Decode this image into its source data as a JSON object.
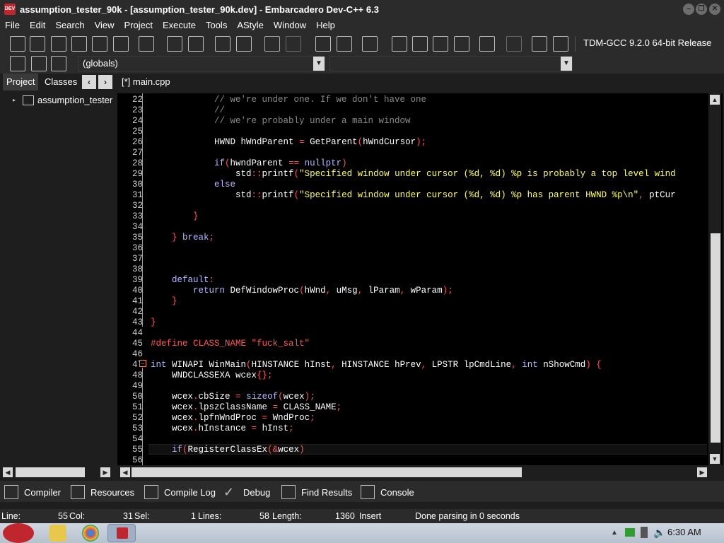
{
  "window": {
    "title": "assumption_tester_90k - [assumption_tester_90k.dev] - Embarcadero Dev-C++ 6.3",
    "logo_text": "DEV"
  },
  "menu": [
    "File",
    "Edit",
    "Search",
    "View",
    "Project",
    "Execute",
    "Tools",
    "AStyle",
    "Window",
    "Help"
  ],
  "toolbar": {
    "compiler": "TDM-GCC 9.2.0 64-bit Release",
    "scope": "(globals)"
  },
  "left_panel": {
    "tabs": [
      "Project",
      "Classes"
    ],
    "tree_item": "assumption_tester"
  },
  "editor": {
    "tab_label": "[*] main.cpp",
    "lines": [
      {
        "n": "22",
        "segs": [
          [
            "cm",
            "            // we're under one. If we don't have one"
          ]
        ]
      },
      {
        "n": "23",
        "segs": [
          [
            "cm",
            "            //"
          ]
        ]
      },
      {
        "n": "24",
        "segs": [
          [
            "cm",
            "            // we're probably under a main window"
          ]
        ]
      },
      {
        "n": "25",
        "segs": []
      },
      {
        "n": "26",
        "segs": [
          [
            "id",
            "            HWND hWndParent "
          ],
          [
            "sy",
            "="
          ],
          [
            "id",
            " GetParent"
          ],
          [
            "sy",
            "("
          ],
          [
            "id",
            "hWndCursor"
          ],
          [
            "sy",
            ");"
          ]
        ]
      },
      {
        "n": "27",
        "segs": []
      },
      {
        "n": "28",
        "segs": [
          [
            "kw",
            "            if"
          ],
          [
            "sy",
            "("
          ],
          [
            "id",
            "hwndParent "
          ],
          [
            "sy",
            "=="
          ],
          [
            "kw",
            " nullptr"
          ],
          [
            "sy",
            ")"
          ]
        ]
      },
      {
        "n": "29",
        "segs": [
          [
            "id",
            "                std"
          ],
          [
            "sy",
            "::"
          ],
          [
            "id",
            "printf"
          ],
          [
            "sy",
            "("
          ],
          [
            "st",
            "\"Specified window under cursor (%d, %d) %p is probably a top level wind"
          ]
        ]
      },
      {
        "n": "30",
        "segs": [
          [
            "kw",
            "            else"
          ]
        ]
      },
      {
        "n": "31",
        "segs": [
          [
            "id",
            "                std"
          ],
          [
            "sy",
            "::"
          ],
          [
            "id",
            "printf"
          ],
          [
            "sy",
            "("
          ],
          [
            "st",
            "\"Specified window under cursor (%d, %d) %p has parent HWND %p\\n\""
          ],
          [
            "sy",
            ","
          ],
          [
            "id",
            " ptCur"
          ]
        ]
      },
      {
        "n": "32",
        "segs": []
      },
      {
        "n": "33",
        "segs": [
          [
            "sy",
            "        }"
          ]
        ]
      },
      {
        "n": "34",
        "segs": []
      },
      {
        "n": "35",
        "segs": [
          [
            "sy",
            "    }"
          ],
          [
            "kw",
            " break"
          ],
          [
            "sy",
            ";"
          ]
        ]
      },
      {
        "n": "36",
        "segs": []
      },
      {
        "n": "37",
        "segs": []
      },
      {
        "n": "38",
        "segs": []
      },
      {
        "n": "39",
        "segs": [
          [
            "kw",
            "    default"
          ],
          [
            "sy",
            ":"
          ]
        ]
      },
      {
        "n": "40",
        "segs": [
          [
            "kw",
            "        return"
          ],
          [
            "id",
            " DefWindowProc"
          ],
          [
            "sy",
            "("
          ],
          [
            "id",
            "hWnd"
          ],
          [
            "sy",
            ","
          ],
          [
            "id",
            " uMsg"
          ],
          [
            "sy",
            ","
          ],
          [
            "id",
            " lParam"
          ],
          [
            "sy",
            ","
          ],
          [
            "id",
            " wParam"
          ],
          [
            "sy",
            ");"
          ]
        ]
      },
      {
        "n": "41",
        "segs": [
          [
            "sy",
            "    }"
          ]
        ]
      },
      {
        "n": "42",
        "segs": []
      },
      {
        "n": "43",
        "segs": [
          [
            "sy",
            "}"
          ]
        ]
      },
      {
        "n": "44",
        "segs": []
      },
      {
        "n": "45",
        "segs": [
          [
            "pp",
            "#define CLASS_NAME \"fuck_salt\""
          ]
        ]
      },
      {
        "n": "46",
        "segs": []
      },
      {
        "n": "47",
        "segs": [
          [
            "kw",
            "int"
          ],
          [
            "id",
            " WINAPI WinMain"
          ],
          [
            "sy",
            "("
          ],
          [
            "id",
            "HINSTANCE hInst"
          ],
          [
            "sy",
            ","
          ],
          [
            "id",
            " HINSTANCE hPrev"
          ],
          [
            "sy",
            ","
          ],
          [
            "id",
            " LPSTR lpCmdLine"
          ],
          [
            "sy",
            ","
          ],
          [
            "kw",
            " int"
          ],
          [
            "id",
            " nShowCmd"
          ],
          [
            "sy",
            ") {"
          ]
        ]
      },
      {
        "n": "48",
        "segs": [
          [
            "id",
            "    WNDCLASSEXA wcex"
          ],
          [
            "sy",
            "{};"
          ]
        ]
      },
      {
        "n": "49",
        "segs": []
      },
      {
        "n": "50",
        "segs": [
          [
            "id",
            "    wcex"
          ],
          [
            "sy",
            "."
          ],
          [
            "id",
            "cbSize "
          ],
          [
            "sy",
            "="
          ],
          [
            "kw",
            " sizeof"
          ],
          [
            "sy",
            "("
          ],
          [
            "id",
            "wcex"
          ],
          [
            "sy",
            ");"
          ]
        ]
      },
      {
        "n": "51",
        "segs": [
          [
            "id",
            "    wcex"
          ],
          [
            "sy",
            "."
          ],
          [
            "id",
            "lpszClassName "
          ],
          [
            "sy",
            "="
          ],
          [
            "id",
            " CLASS_NAME"
          ],
          [
            "sy",
            ";"
          ]
        ]
      },
      {
        "n": "52",
        "segs": [
          [
            "id",
            "    wcex"
          ],
          [
            "sy",
            "."
          ],
          [
            "id",
            "lpfnWndProc "
          ],
          [
            "sy",
            "="
          ],
          [
            "id",
            " WndProc"
          ],
          [
            "sy",
            ";"
          ]
        ]
      },
      {
        "n": "53",
        "segs": [
          [
            "id",
            "    wcex"
          ],
          [
            "sy",
            "."
          ],
          [
            "id",
            "hInstance "
          ],
          [
            "sy",
            "="
          ],
          [
            "id",
            " hInst"
          ],
          [
            "sy",
            ";"
          ]
        ]
      },
      {
        "n": "54",
        "segs": []
      },
      {
        "n": "55",
        "segs": [
          [
            "kw",
            "    if"
          ],
          [
            "sy",
            "("
          ],
          [
            "id",
            "RegisterClassEx"
          ],
          [
            "sy",
            "(&"
          ],
          [
            "id",
            "wcex"
          ],
          [
            "sy",
            ")"
          ]
        ]
      },
      {
        "n": "56",
        "segs": []
      }
    ]
  },
  "bottom_tabs": [
    "Compiler",
    "Resources",
    "Compile Log",
    "Debug",
    "Find Results",
    "Console"
  ],
  "status": {
    "line_label": "Line:",
    "line_value": "55",
    "col_label": "Col:",
    "col_value": "31",
    "sel_label": "Sel:",
    "sel_value": "1",
    "lines_label": "Lines:",
    "lines_value": "58",
    "length_label": "Length:",
    "length_value": "1360",
    "mode": "Insert",
    "message": "Done parsing in 0 seconds"
  },
  "taskbar": {
    "clock": "6:30 AM"
  }
}
